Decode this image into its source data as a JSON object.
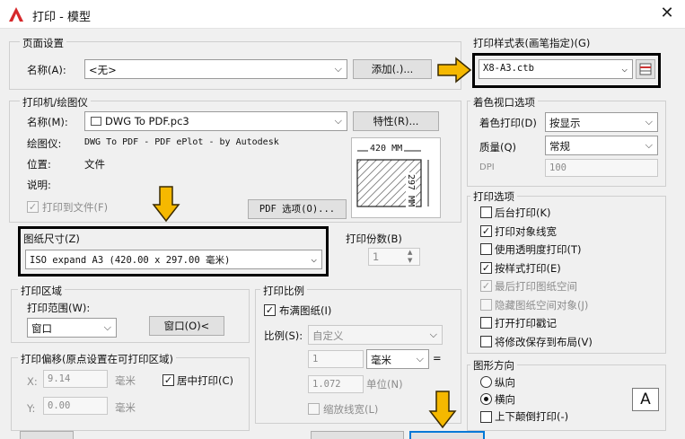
{
  "window": {
    "title": "打印 - 模型",
    "close_glyph": "✕",
    "app_icon_letter": "A",
    "app_icon_color": "#d6282b"
  },
  "page_setup": {
    "group_title": "页面设置",
    "name_label": "名称(A):",
    "name_value": "<无>",
    "add_button": "添加(.)..."
  },
  "printer": {
    "group_title": "打印机/绘图仪",
    "name_label": "名称(M):",
    "name_value": "DWG To PDF.pc3",
    "properties_button": "特性(R)...",
    "plotter_label": "绘图仪:",
    "plotter_value": "DWG To PDF - PDF ePlot - by Autodesk",
    "location_label": "位置:",
    "location_value": "文件",
    "description_label": "说明:",
    "print_to_file": "打印到文件(F)",
    "pdf_options_button": "PDF 选项(O)...",
    "preview": {
      "width": "420 MM",
      "height": "297 MM"
    }
  },
  "paper_size": {
    "group_title": "图纸尺寸(Z)",
    "value": "ISO expand A3 (420.00 x 297.00 毫米)"
  },
  "copies": {
    "label": "打印份数(B)",
    "value": "1"
  },
  "plot_area": {
    "group_title": "打印区域",
    "what_label": "打印范围(W):",
    "what_value": "窗口",
    "window_button": "窗口(O)<"
  },
  "plot_offset": {
    "group_title": "打印偏移(原点设置在可打印区域)",
    "x_label": "X:",
    "x_value": "9.14",
    "x_unit": "毫米",
    "y_label": "Y:",
    "y_value": "0.00",
    "y_unit": "毫米",
    "center": "居中打印(C)"
  },
  "plot_scale": {
    "group_title": "打印比例",
    "fit_paper": "布满图纸(I)",
    "scale_label": "比例(S):",
    "scale_value": "自定义",
    "value1": "1",
    "unit": "毫米",
    "equals": "=",
    "value2": "1.072",
    "unit_label": "单位(N)",
    "scale_lineweights": "缩放线宽(L)"
  },
  "plot_style_table": {
    "group_title": "打印样式表(画笔指定)(G)",
    "value": "X8-A3.ctb"
  },
  "shaded_viewport": {
    "group_title": "着色视口选项",
    "shade_label": "着色打印(D)",
    "shade_value": "按显示",
    "quality_label": "质量(Q)",
    "quality_value": "常规",
    "dpi_label": "DPI",
    "dpi_value": "100"
  },
  "plot_options": {
    "group_title": "打印选项",
    "items": [
      {
        "label": "后台打印(K)",
        "check": ""
      },
      {
        "label": "打印对象线宽",
        "check": "✓"
      },
      {
        "label": "使用透明度打印(T)",
        "check": ""
      },
      {
        "label": "按样式打印(E)",
        "check": "✓"
      },
      {
        "label": "最后打印图纸空间",
        "check": "✓"
      },
      {
        "label": "隐藏图纸空间对象(J)",
        "check": ""
      },
      {
        "label": "打开打印戳记",
        "check": ""
      },
      {
        "label": "将修改保存到布局(V)",
        "check": ""
      }
    ]
  },
  "orientation": {
    "group_title": "图形方向",
    "portrait": "纵向",
    "landscape": "横向",
    "upside_down": "上下颠倒打印(-)",
    "page_letter": "A"
  },
  "annotation": {
    "arrow_color": "#f5b800"
  }
}
